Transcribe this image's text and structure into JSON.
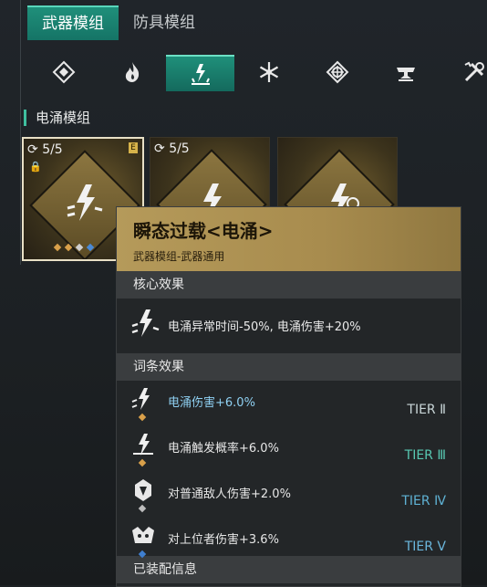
{
  "top_tabs": [
    {
      "label": "武器模组",
      "active": true
    },
    {
      "label": "防具模组",
      "active": false
    }
  ],
  "element_tabs": [
    {
      "icon": "diamond-icon",
      "active": false
    },
    {
      "icon": "fire-icon",
      "active": false
    },
    {
      "icon": "surge-icon",
      "active": true
    },
    {
      "icon": "snowflake-icon",
      "active": false
    },
    {
      "icon": "shield-crest-icon",
      "active": false
    },
    {
      "icon": "anvil-icon",
      "active": false
    },
    {
      "icon": "tools-icon",
      "active": false
    }
  ],
  "section_title": "电涌模组",
  "cards": [
    {
      "count": "5/5",
      "lock": "🔒",
      "badge": "E",
      "selected": true
    },
    {
      "count": "5/5",
      "selected": false
    },
    {
      "count": "",
      "selected": false
    }
  ],
  "tooltip": {
    "title": "瞬态过载<电涌>",
    "subtitle": "武器模组-武器通用",
    "core_header": "核心效果",
    "core_text": "电涌异常时间-50%, 电涌伤害+20%",
    "entries_header": "词条效果",
    "entries": [
      {
        "text": "电涌伤害+6.0%",
        "tier": "TIER Ⅱ",
        "gem_color": "#d9a04a"
      },
      {
        "text": "电涌触发概率+6.0%",
        "tier": "TIER Ⅲ",
        "gem_color": "#d9a04a"
      },
      {
        "text": "对普通敌人伤害+2.0%",
        "tier": "TIER Ⅳ",
        "gem_color": "#bdbdbd"
      },
      {
        "text": "对上位者伤害+3.6%",
        "tier": "TIER Ⅴ",
        "gem_color": "#3f7fd0"
      }
    ],
    "equipped_header": "已装配信息"
  },
  "colors": {
    "accent": "#1f8f7a",
    "gold": "#b59a5a",
    "highlight_text": "#8fd0f2"
  }
}
